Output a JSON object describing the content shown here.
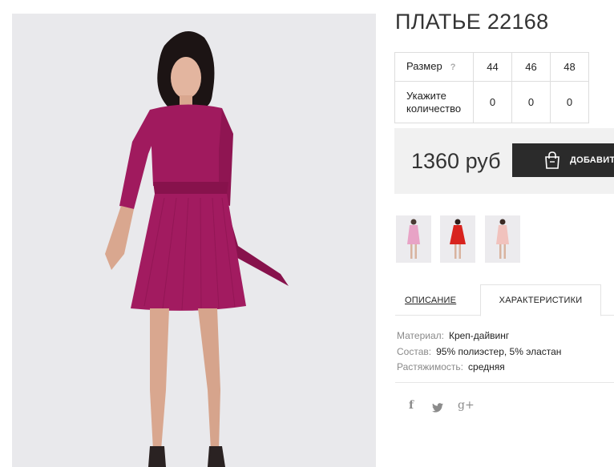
{
  "product": {
    "title": "ПЛАТЬЕ 22168",
    "price": "1360 руб",
    "add_to_cart_label": "ДОБАВИТ",
    "color_accent": "#9c1658"
  },
  "sizes": {
    "size_label": "Размер",
    "help_icon": "?",
    "values": [
      "44",
      "46",
      "48"
    ],
    "quantity_label_line1": "Укажите",
    "quantity_label_line2": "количество",
    "quantities": [
      "0",
      "0",
      "0"
    ]
  },
  "thumbnails": [
    {
      "name": "pink-dress",
      "color": "#e8a3c6"
    },
    {
      "name": "red-dress",
      "color": "#d8231e"
    },
    {
      "name": "peach-dress",
      "color": "#f1c2bd"
    }
  ],
  "tabs": {
    "description": "ОПИСАНИЕ",
    "characteristics": "ХАРАКТЕРИСТИКИ"
  },
  "specs": [
    {
      "key": "Материал:",
      "value": "Креп-дайвинг"
    },
    {
      "key": "Состав:",
      "value": "95% полиэстер, 5% эластан"
    },
    {
      "key": "Растяжимость:",
      "value": "средняя"
    }
  ],
  "social": {
    "facebook": "f",
    "twitter": "twitter-icon",
    "googleplus": "g+"
  }
}
